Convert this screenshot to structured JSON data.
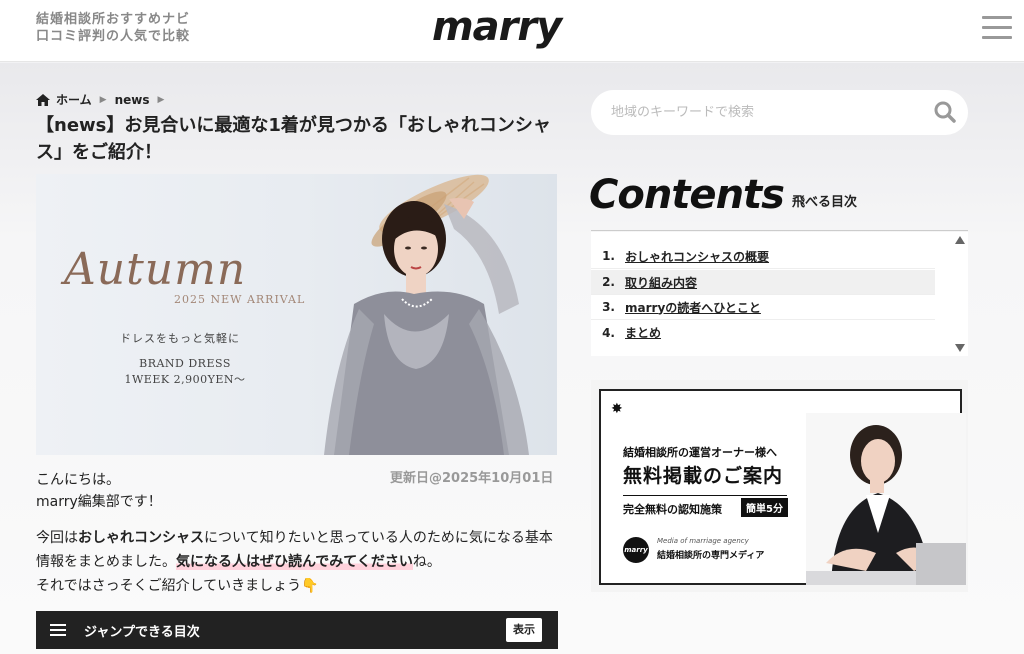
{
  "header": {
    "tagline_line1": "結婚相談所おすすめナビ",
    "tagline_line2": "口コミ評判の人気で比較",
    "logo": "marry"
  },
  "breadcrumb": {
    "home": "ホーム",
    "category": "news"
  },
  "article": {
    "title": "【news】お見合いに最適な1着が見つかる「おしゃれコンシャス」をご紹介！",
    "hero": {
      "autumn": "Autumn",
      "arrival": "2025 NEW ARRIVAL",
      "jp_copy": "ドレスをもっと気軽に",
      "brand_line1": "BRAND DRESS",
      "brand_line2": "1WEEK 2,900YEN〜"
    },
    "greeting": "こんにちは。",
    "editor": "marry編集部です！",
    "updated": "更新日@2025年10月01日",
    "body_pre": "今回は",
    "body_bold": "おしゃれコンシャス",
    "body_mid": "について知りたいと思っている人のために気になる基本情報をまとめました。",
    "body_highlight": "気になる人はぜひ読んでみてください",
    "body_end": "ね。",
    "body_line3": "それではさっそくご紹介していきましょう👇"
  },
  "toc_bar": {
    "label": "ジャンプできる目次",
    "toggle": "表示"
  },
  "sidebar": {
    "search_placeholder": "地域のキーワードで検索",
    "contents_title": "Contents",
    "contents_sub": "飛べる目次",
    "toc": [
      {
        "num": "1.",
        "label": "おしゃれコンシャスの概要"
      },
      {
        "num": "2.",
        "label": "取り組み内容"
      },
      {
        "num": "3.",
        "label": "marryの読者へひとこと"
      },
      {
        "num": "4.",
        "label": "まとめ"
      }
    ],
    "banner": {
      "sub": "結婚相談所の運営オーナー様へ",
      "main": "無料掲載のご案内",
      "free": "完全無料の認知施策",
      "badge": "簡単5分",
      "logo": "marry",
      "media_en": "Media of marriage agency",
      "media": "結婚相談所の専門メディア"
    }
  }
}
